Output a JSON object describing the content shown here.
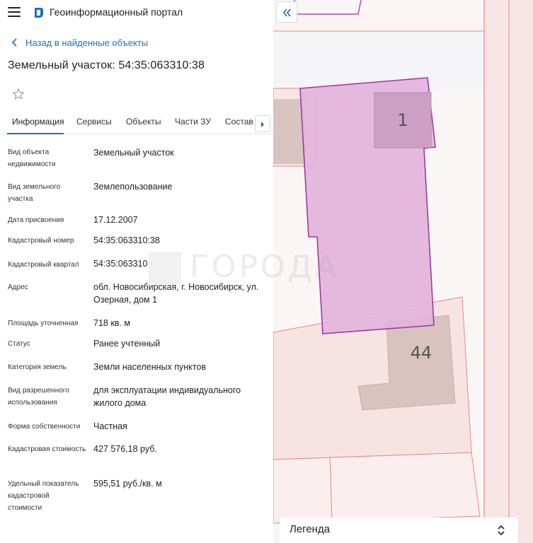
{
  "header": {
    "title": "Геоинформационный портал"
  },
  "nav": {
    "back_label": "Назад в найденные объекты"
  },
  "object": {
    "title": "Земельный участок: 54:35:063310:38"
  },
  "tabs": [
    {
      "label": "Информация",
      "active": true
    },
    {
      "label": "Сервисы",
      "active": false
    },
    {
      "label": "Объекты",
      "active": false
    },
    {
      "label": "Части ЗУ",
      "active": false
    },
    {
      "label": "Состав",
      "active": false
    }
  ],
  "fields": [
    {
      "label": "Вид объекта недвижимости",
      "value": "Земельный участок"
    },
    {
      "label": "Вид земельного участка",
      "value": "Землепользование"
    },
    {
      "label": "Дата присвоения",
      "value": "17.12.2007"
    },
    {
      "label": "Кадастровый номер",
      "value": "54:35:063310:38"
    },
    {
      "label": "Кадастровый квартал",
      "value": "54:35:063310"
    },
    {
      "label": "Адрес",
      "value": "обл. Новосибирская, г. Новосибирск, ул. Озерная, дом 1"
    },
    {
      "label": "Площадь уточненная",
      "value": "718 кв. м"
    },
    {
      "label": "Статус",
      "value": "Ранее учтенный"
    },
    {
      "label": "Категория земель",
      "value": "Земли населенных пунктов"
    },
    {
      "label": "Вид разрешенного использования",
      "value": "для эксплуатации индивидуального жилого дома"
    },
    {
      "label": "Форма собственности",
      "value": "Частная"
    },
    {
      "label": "Кадастровая стоимость",
      "value": "427 576,18 руб."
    },
    {
      "label": "Удельный показатель кадастровой стоимости",
      "value": "595,51 руб./кв. м"
    }
  ],
  "map": {
    "building_numbers": [
      "1",
      "44"
    ],
    "legend_label": "Легенда"
  },
  "watermark": "ГОРОДА",
  "colors": {
    "accent": "#1e6fbf",
    "parcel_fill": "#e2b3dc",
    "parcel_stroke": "#a03aa0",
    "parcel_border": "#e77f74",
    "building_fill": "#d9c3bf"
  },
  "icons": {
    "menu": "hamburger-icon",
    "logo": "portal-logo-icon",
    "back": "chevron-left-icon",
    "favorite": "star-outline-icon",
    "tabs_next": "chevron-right-icon",
    "collapse": "double-chevron-left-icon",
    "legend_toggle": "chevron-up-down-icon"
  }
}
